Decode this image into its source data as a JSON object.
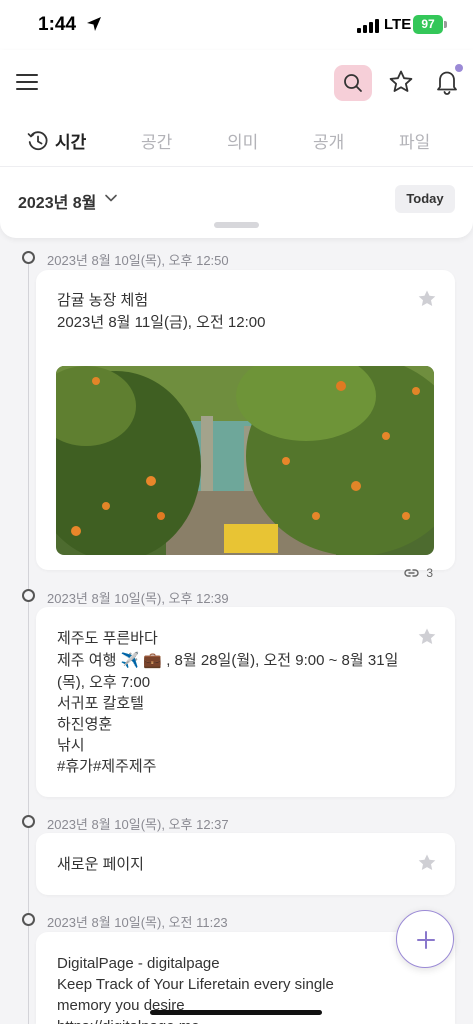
{
  "status_bar": {
    "time": "1:44",
    "network": "LTE",
    "battery": "97"
  },
  "tabs": [
    {
      "label": "시간",
      "active": true
    },
    {
      "label": "공간",
      "active": false
    },
    {
      "label": "의미",
      "active": false
    },
    {
      "label": "공개",
      "active": false
    },
    {
      "label": "파일",
      "active": false
    }
  ],
  "month_selector": {
    "label": "2023년 8월"
  },
  "today_button": "Today",
  "timeline": [
    {
      "date": "2023년 8월 10일(목), 오후 12:50",
      "lines": [
        "감귤 농장 체험",
        "2023년 8월 11일(금), 오전 12:00"
      ],
      "link_count": "3"
    },
    {
      "date": "2023년 8월 10일(목), 오후 12:39",
      "lines": [
        "제주도 푸른바다",
        "제주 여행 ✈️ 💼 , 8월 28일(월), 오전 9:00 ~ 8월 31일",
        "(목), 오후 7:00",
        "서귀포 칼호텔",
        "하진영훈",
        "낚시",
        "#휴가#제주제주"
      ]
    },
    {
      "date": "2023년 8월 10일(목), 오후 12:37",
      "lines": [
        "새로운 페이지"
      ]
    },
    {
      "date": "2023년 8월 10일(목), 오전 11:23",
      "lines": [
        "DigitalPage - digitalpage",
        "Keep Track of Your Liferetain every single",
        "memory you desire",
        "https://digitalpage.me"
      ]
    }
  ],
  "colors": {
    "accent": "#9b8ad6",
    "search_bg": "#f6cfd8",
    "battery": "#34c759"
  },
  "icons": [
    "location-arrow-icon",
    "menu-icon",
    "search-icon",
    "star-icon",
    "bell-icon",
    "clock-icon",
    "chevron-down-icon",
    "link-icon",
    "plus-icon"
  ]
}
